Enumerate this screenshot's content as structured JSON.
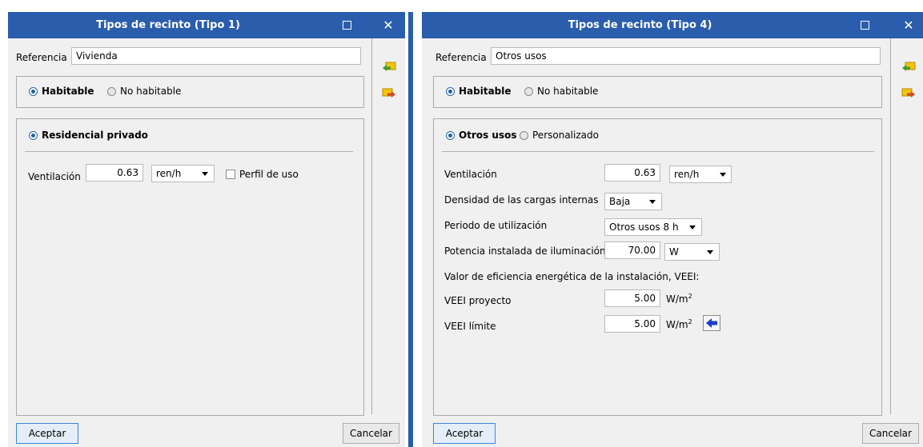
{
  "win1": {
    "title": "Tipos de recinto (Tipo 1)",
    "referencia_label": "Referencia",
    "referencia_value": "Vivienda",
    "habitable_label": "Habitable",
    "no_habitable_label": "No habitable",
    "uso_label": "Residencial privado",
    "ventilacion_label": "Ventilación",
    "ventilacion_value": "0.63",
    "ventilacion_unit": "ren/h",
    "perfil_label": "Perfil de uso",
    "aceptar": "Aceptar",
    "cancelar": "Cancelar"
  },
  "win2": {
    "title": "Tipos de recinto (Tipo 4)",
    "referencia_label": "Referencia",
    "referencia_value": "Otros usos",
    "habitable_label": "Habitable",
    "no_habitable_label": "No habitable",
    "otros_usos_label": "Otros usos",
    "personalizado_label": "Personalizado",
    "ventilacion_label": "Ventilación",
    "ventilacion_value": "0.63",
    "ventilacion_unit": "ren/h",
    "densidad_label": "Densidad de las cargas internas",
    "densidad_value": "Baja",
    "periodo_label": "Periodo de utilización",
    "periodo_value": "Otros usos 8 h",
    "potencia_label": "Potencia instalada de iluminación",
    "potencia_value": "70.00",
    "potencia_unit": "W",
    "veei_heading": "Valor de eficiencia energética de la instalación, VEEI:",
    "veei_proyecto_label": "VEEI proyecto",
    "veei_proyecto_value": "5.00",
    "veei_limite_label": "VEEI límite",
    "veei_limite_value": "5.00",
    "veei_unit": "W/m",
    "veei_unit_sup": "2",
    "aceptar": "Aceptar",
    "cancelar": "Cancelar"
  },
  "icons": [
    "import-icon",
    "export-icon",
    "maximize-icon",
    "close-icon",
    "arrow-left-icon"
  ],
  "colors": {
    "titlebar": "#2a5dab",
    "window_bg": "#f0f0f0",
    "accent_border": "#3b86d6",
    "arrow_blue": "#1a3fd0"
  }
}
